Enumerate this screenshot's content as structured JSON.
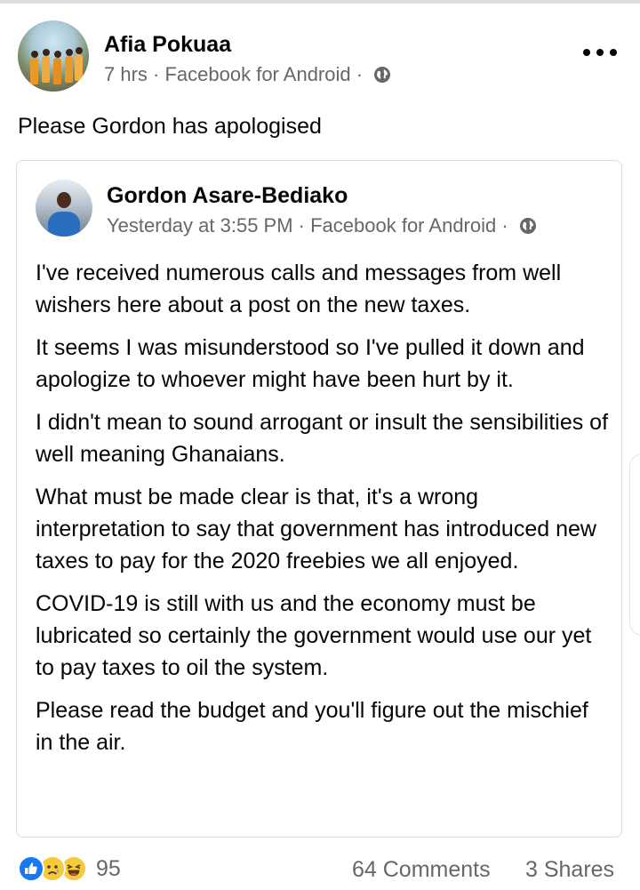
{
  "post": {
    "author": "Afia Pokuaa",
    "time": "7 hrs",
    "source": "Facebook for Android",
    "separator": " · ",
    "text": "Please Gordon has apologised"
  },
  "shared_post": {
    "author": "Gordon Asare-Bediako",
    "time": "Yesterday at 3:55 PM",
    "source": "Facebook for Android",
    "separator": " · ",
    "paragraphs": [
      "I've received numerous calls and messages from well wishers here about a post on the new taxes.",
      "It seems I was misunderstood so I've pulled it down and apologize to whoever might have been hurt by it.",
      "I didn't mean to sound arrogant or insult the sensibilities of well meaning Ghanaians.",
      "What must be made clear is that, it's a wrong interpretation to say that government has introduced new taxes to pay for the 2020 freebies we all enjoyed.",
      "COVID-19 is still with us and the economy must be lubricated so certainly the government would use our yet to pay taxes to oil the system.",
      "Please read the budget and you'll figure out the mischief in the air."
    ]
  },
  "footer": {
    "reaction_icons": [
      "like-icon",
      "sad-icon",
      "haha-icon"
    ],
    "reaction_count": "95",
    "comments": "64 Comments",
    "shares": "3 Shares"
  },
  "colors": {
    "meta_text": "#65676b",
    "like_blue": "#1877f2",
    "emoji_yellow": "#f7c93c",
    "border": "#dadde1"
  }
}
